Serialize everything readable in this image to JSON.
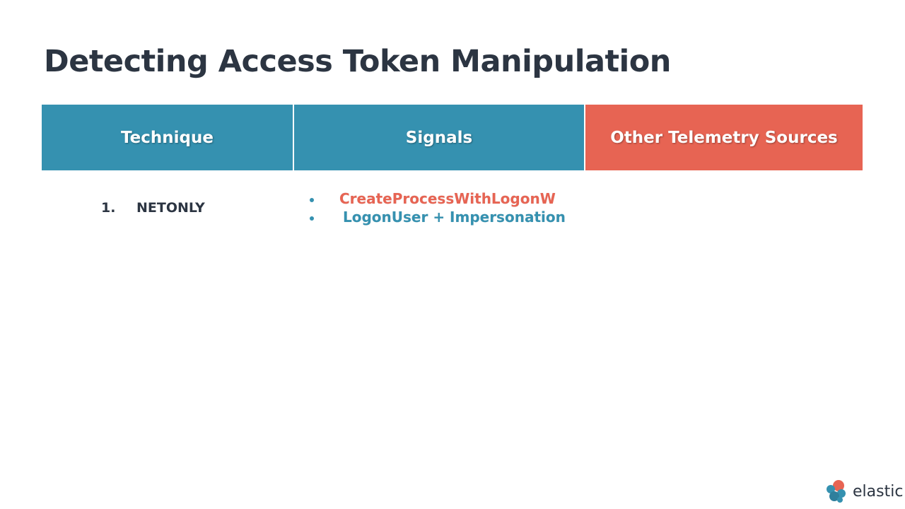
{
  "title": "Detecting Access Token Manipulation",
  "table": {
    "headers": [
      "Technique",
      "Signals",
      "Other Telemetry Sources"
    ],
    "header_colors": {
      "technique": "#3591b0",
      "signals": "#3591b0",
      "other": "#e76453"
    },
    "rows": [
      {
        "number": "1.",
        "technique": "NETONLY",
        "signals": [
          {
            "text": "CreateProcessWithLogonW",
            "color": "#e76453"
          },
          {
            "text": "LogonUser + Impersonation",
            "color": "#3591b0"
          }
        ]
      }
    ]
  },
  "logo": {
    "text": "elastic",
    "icon": "elastic-logo-icon"
  }
}
